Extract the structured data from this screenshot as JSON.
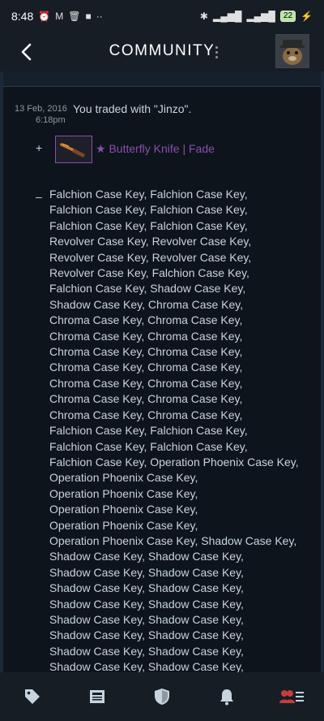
{
  "status_bar": {
    "time": "8:48",
    "battery": "22"
  },
  "header": {
    "title": "COMMUNITY"
  },
  "trade": {
    "date": "13 Feb, 2016",
    "time": "6:18pm",
    "message": "You traded with \"Jinzo\".",
    "received_sign": "+",
    "received_item": "★ Butterfly Knife | Fade",
    "given_sign": "–",
    "given_lines": [
      "Falchion Case Key, Falchion Case Key,",
      "Falchion Case Key, Falchion Case Key,",
      "Falchion Case Key, Falchion Case Key,",
      "Revolver Case Key, Revolver Case Key,",
      "Revolver Case Key, Revolver Case Key,",
      "Revolver Case Key, Falchion Case Key,",
      "Falchion Case Key, Shadow Case Key,",
      "Shadow Case Key, Chroma Case Key,",
      "Chroma Case Key, Chroma Case Key,",
      "Chroma Case Key, Chroma Case Key,",
      "Chroma Case Key, Chroma Case Key,",
      "Chroma Case Key, Chroma Case Key,",
      "Chroma Case Key, Chroma Case Key,",
      "Chroma Case Key, Chroma Case Key,",
      "Chroma Case Key, Chroma Case Key,",
      "Falchion Case Key, Falchion Case Key,",
      "Falchion Case Key, Falchion Case Key,",
      "Falchion Case Key, Operation Phoenix Case Key,",
      "Operation Phoenix Case Key,",
      "Operation Phoenix Case Key,",
      "Operation Phoenix Case Key,",
      "Operation Phoenix Case Key,",
      "Operation Phoenix Case Key, Shadow Case Key,",
      "Shadow Case Key, Shadow Case Key,",
      "Shadow Case Key, Shadow Case Key,",
      "Shadow Case Key, Shadow Case Key,",
      "Shadow Case Key, Shadow Case Key,",
      "Shadow Case Key, Shadow Case Key,",
      "Shadow Case Key, Shadow Case Key,",
      "Shadow Case Key, Shadow Case Key,",
      "Shadow Case Key, Shadow Case Key,"
    ]
  },
  "bottom_nav": {
    "items": [
      "tag-icon",
      "news-icon",
      "shield-icon",
      "bell-icon",
      "friends-icon"
    ],
    "active_color": "#c43d3d"
  },
  "colors": {
    "background": "#1b2838",
    "rarity_covert": "#8650ac",
    "text": "#c6d4df"
  }
}
